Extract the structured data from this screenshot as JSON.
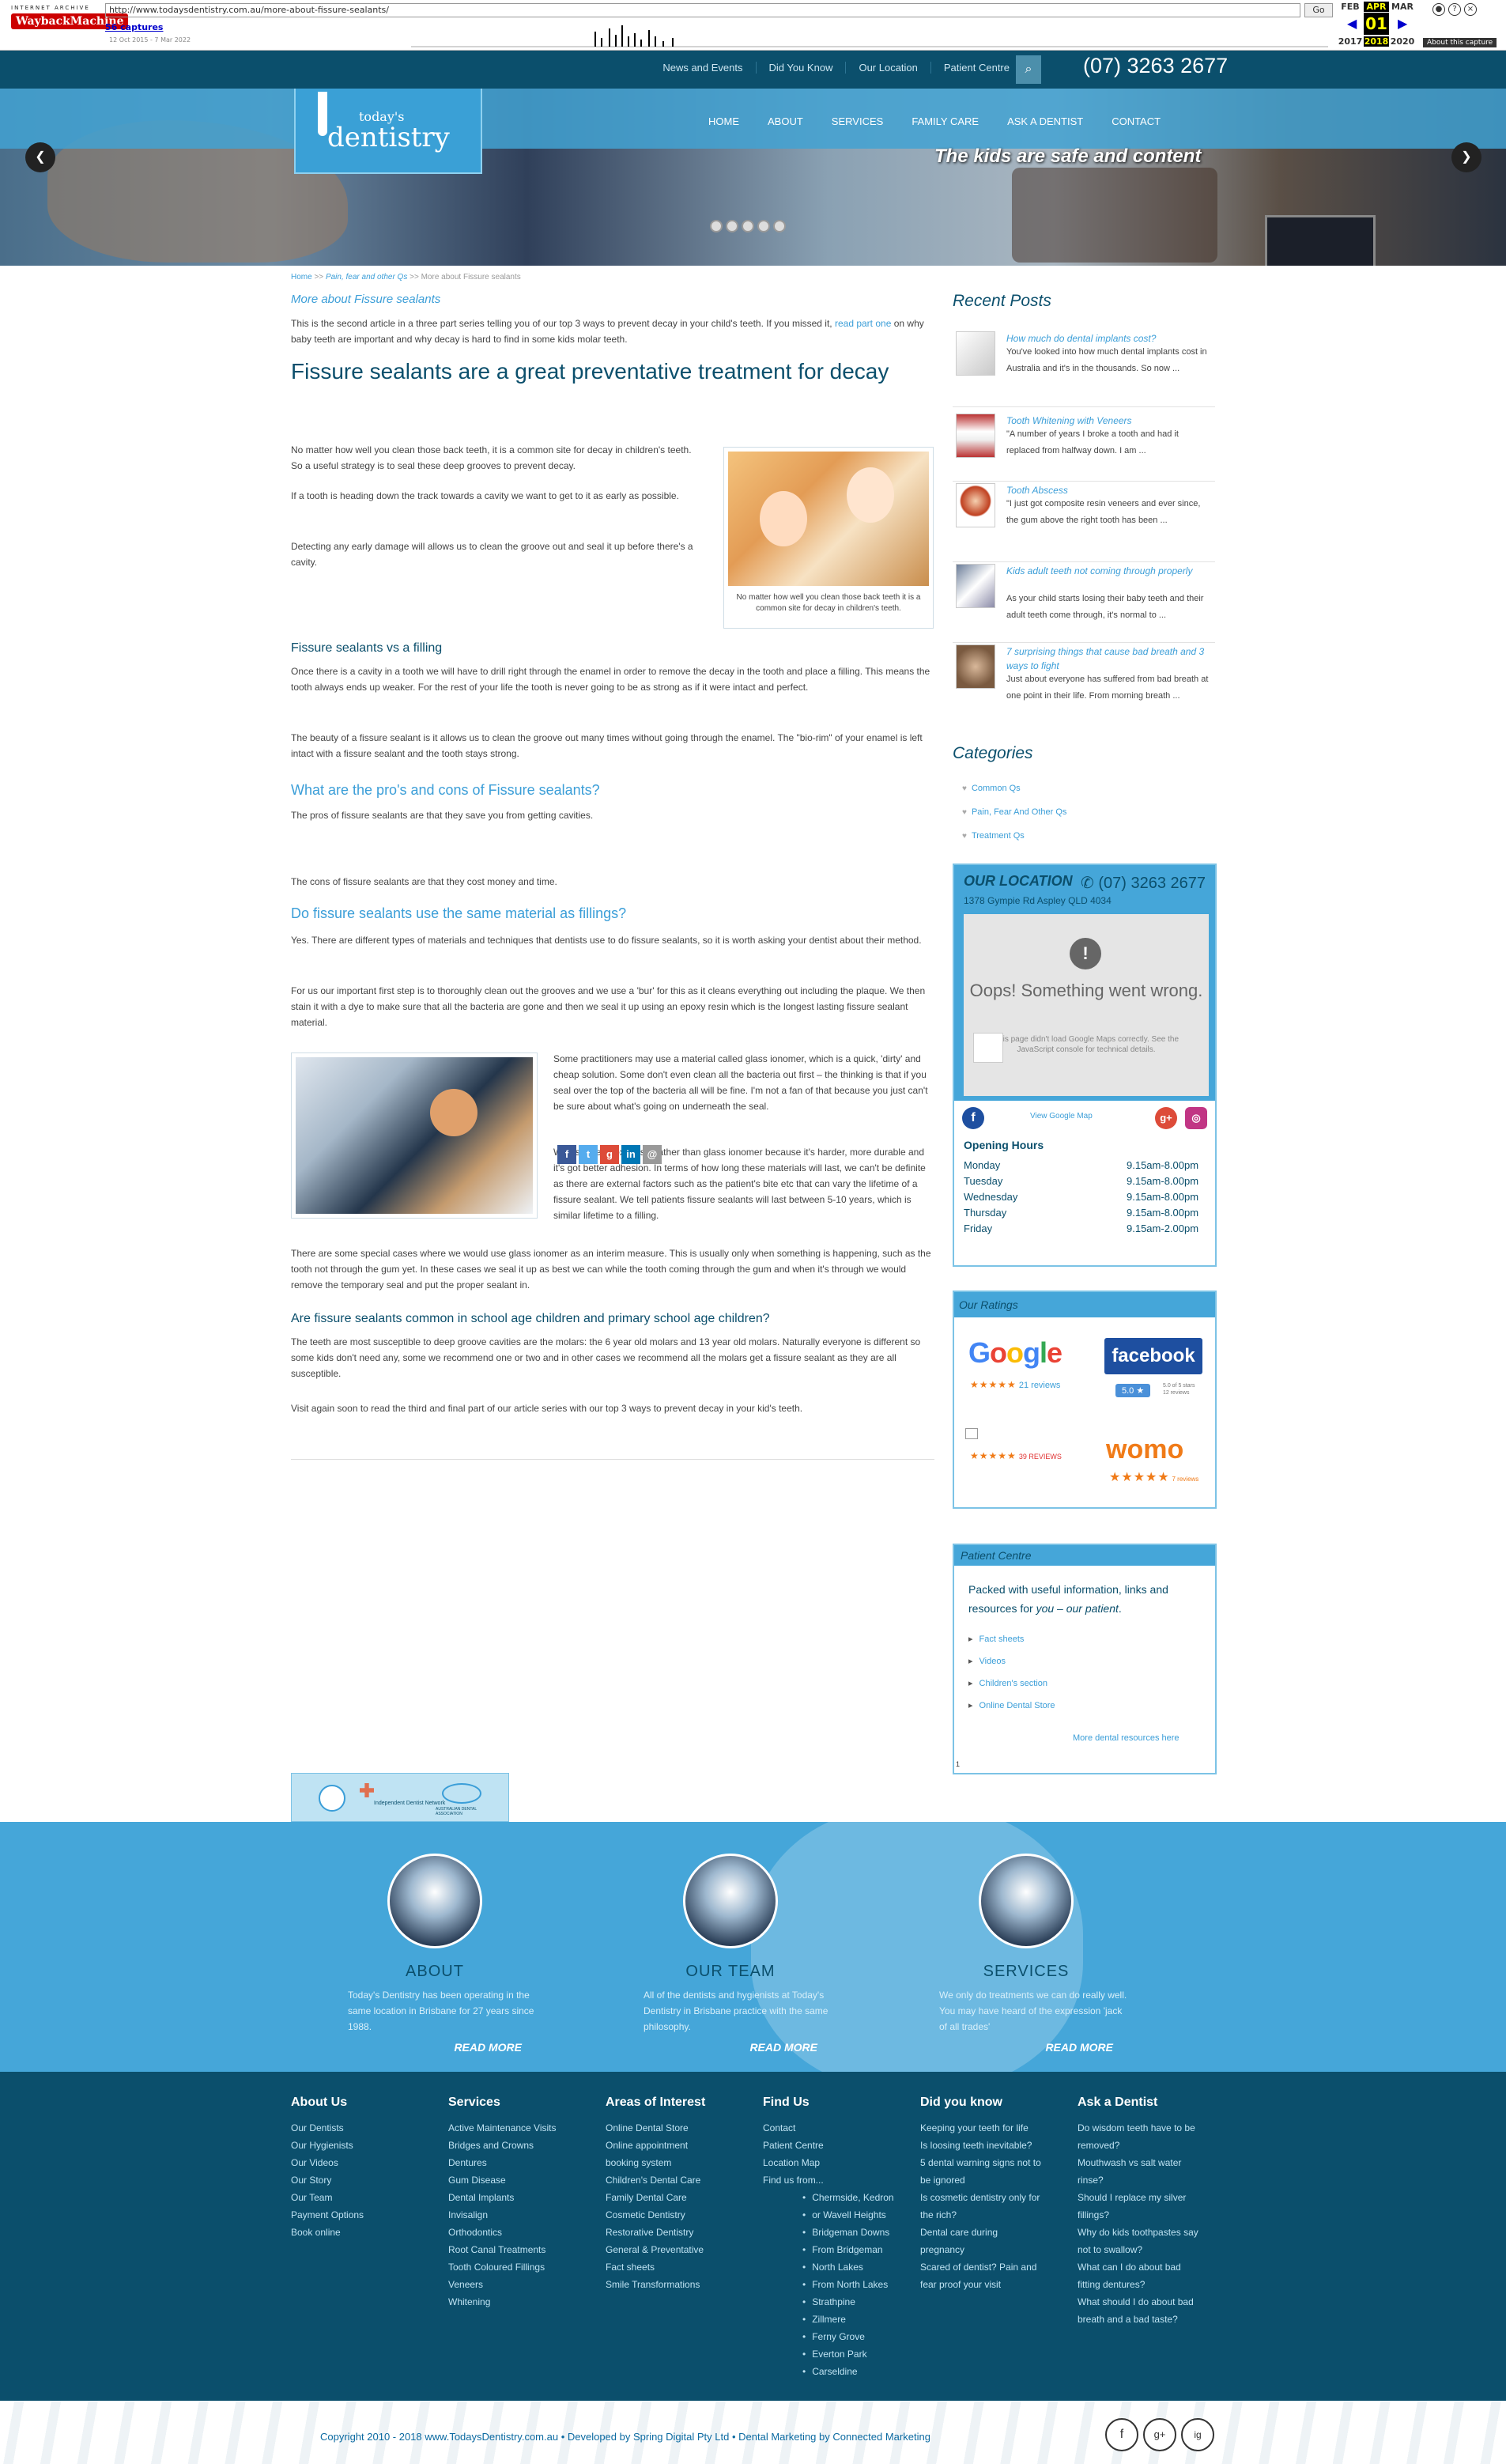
{
  "wayback": {
    "logo_top": "INTERNET ARCHIVE",
    "logo_main": "WaybackMachine",
    "url": "http://www.todaysdentistry.com.au/more-about-fissure-sealants/",
    "go": "Go",
    "captures": "56 captures",
    "range": "12 Oct 2015 - 7 Mar 2022",
    "months": [
      "FEB",
      "APR",
      "MAR"
    ],
    "day": "01",
    "years": [
      "2017",
      "2018",
      "2020"
    ],
    "about": "About this capture"
  },
  "topbar": {
    "links": [
      "News and Events",
      "Did You Know",
      "Our Location",
      "Patient Centre"
    ],
    "phone": "(07) 3263 2677"
  },
  "brand": {
    "todays": "today's",
    "dentistry": "dentistry"
  },
  "menu": [
    "HOME",
    "ABOUT",
    "SERVICES",
    "FAMILY CARE",
    "ASK A DENTIST",
    "CONTACT"
  ],
  "hero": {
    "caption": "The kids are safe and content",
    "slides": 5
  },
  "breadcrumb": {
    "home": "Home",
    "sep": ">>",
    "cat": "Pain, fear and other Qs",
    "current": "More about Fissure sealants"
  },
  "article": {
    "subtitle": "More about Fissure sealants",
    "intro_a": "This is the second article in a three part series telling you of our top 3 ways to prevent decay in your child's teeth. If you missed it,",
    "intro_link": "read part one",
    "intro_b": "on why baby teeth are important and why decay is hard to find in some kids molar teeth.",
    "h1": "Fissure sealants are a great preventative treatment for decay",
    "p1": "No matter how well you clean those back teeth, it is a common site for decay in children's teeth. So a useful strategy is to seal these deep grooves to prevent decay.",
    "p2": "If a tooth is heading down the track towards a cavity we want to get to it as early as possible.",
    "p3": "Detecting any early damage will allows us to clean the groove out and seal it up before there's a cavity.",
    "fig_caption": "No matter how well you clean those back teeth it is a common site for decay in children's teeth.",
    "h_filling": "Fissure sealants vs a filling",
    "p4": "Once there is a cavity in a tooth we will have to drill right through the enamel in order to remove the decay in the tooth and place a filling. This means the tooth always ends up weaker. For the rest of your life the tooth is never going to be as strong as if it were intact and perfect.",
    "p5": "The beauty of a fissure sealant is it allows us to clean the groove out many times without going through the enamel. The \"bio-rim\" of your enamel is left intact with a fissure sealant and the tooth stays strong.",
    "h_pros": "What are the pro's and cons of Fissure sealants?",
    "p6": "The pros of fissure sealants are that they save you from getting cavities.",
    "p7": "The cons of fissure sealants are that they cost money and time.",
    "h_same": "Do fissure sealants use the same material as fillings?",
    "p8": "Yes. There are different types of materials and techniques that dentists use to do fissure sealants, so it is worth asking your dentist about their method.",
    "p9": "For us our important first step is to thoroughly clean out the grooves and we use a 'bur' for this as it cleans everything out including the plaque. We then stain it with a dye to make sure that all the bacteria are gone and then we seal it up using an epoxy resin which is the longest lasting fissure sealant material.",
    "p10": "Some practitioners may use a material called glass ionomer, which is a quick, 'dirty' and cheap solution. Some don't even clean all the bacteria out first – the thinking is that if you seal over the top of the bacteria all will be fine. I'm not a fan of that because you just can't be sure about what's going on underneath the seal.",
    "p11": "We use the epoxy resin rather than glass ionomer because it's harder, more durable and it's got better adhesion. In terms of how long these materials will last, we can't be definite as there are external factors such as the patient's bite etc that can vary the lifetime of a fissure sealant. We tell patients fissure sealants will last between 5-10 years, which is similar lifetime to a filling.",
    "p12": "There are some special cases where we would use glass ionomer as an interim measure. This is usually only when something is happening, such as the tooth not through the gum yet. In these cases we seal it up as best we can while the tooth coming through the gum and when it's through we would remove the temporary seal and put the proper sealant in.",
    "h_school": "Are fissure sealants common in school age children and primary school age children?",
    "p13": "The teeth are most susceptible to deep groove cavities are the molars: the 6 year old molars and 13 year old molars. Naturally everyone is different so some kids don't need any, some we recommend one or two and in other cases we recommend all the molars get a fissure sealant as they are all susceptible.",
    "p14": "Visit again soon to read the third and final part of our article series with our top 3 ways to prevent decay in your kid's teeth."
  },
  "share": [
    {
      "icon": "f",
      "color": "#3b5998"
    },
    {
      "icon": "t",
      "color": "#55acee"
    },
    {
      "icon": "g",
      "color": "#dd4b39"
    },
    {
      "icon": "in",
      "color": "#0077b5"
    },
    {
      "icon": "@",
      "color": "#999999"
    }
  ],
  "sidebar": {
    "recent_title": "Recent Posts",
    "posts": [
      {
        "title": "How much do dental implants cost?",
        "excerpt": "You've looked into how much dental implants cost in Australia and it's in the thousands. So now ..."
      },
      {
        "title": "Tooth Whitening with Veneers",
        "excerpt": "\"A number of years I broke a tooth and had it replaced from halfway down. I am ..."
      },
      {
        "title": "Tooth Abscess",
        "excerpt": "\"I just got composite resin veneers and ever since, the gum above the right tooth has been ..."
      },
      {
        "title": "Kids adult teeth not coming through properly",
        "excerpt": "As your child starts losing their baby teeth and their adult teeth come through, it's normal to ..."
      },
      {
        "title": "7 surprising things that cause bad breath and 3 ways to fight",
        "excerpt": "Just about everyone has suffered from bad breath at one point in their life. From morning breath ..."
      }
    ],
    "cat_title": "Categories",
    "categories": [
      "Common Qs",
      "Pain, Fear And Other Qs",
      "Treatment Qs"
    ]
  },
  "location": {
    "title": "OUR LOCATION",
    "phone": "(07) 3263 2677",
    "address": "1378 Gympie Rd Aspley QLD 4034",
    "map_error": "Oops! Something went wrong.",
    "map_note": "This page didn't load Google Maps correctly. See the JavaScript console for technical details.",
    "view_map": "View Google Map",
    "hours_title": "Opening Hours",
    "hours": [
      {
        "day": "Monday",
        "time": "9.15am-8.00pm"
      },
      {
        "day": "Tuesday",
        "time": "9.15am-8.00pm"
      },
      {
        "day": "Wednesday",
        "time": "9.15am-8.00pm"
      },
      {
        "day": "Thursday",
        "time": "9.15am-8.00pm"
      },
      {
        "day": "Friday",
        "time": "9.15am-2.00pm"
      }
    ]
  },
  "ratings": {
    "title": "Our Ratings",
    "google": "Google",
    "google_reviews": "21 reviews",
    "facebook": "facebook",
    "fb_score": "5.0",
    "fb_note": "5.0 of 5 stars",
    "fb_reviews": "12 reviews",
    "other_reviews": "39 REVIEWS",
    "womo": "womo",
    "womo_reviews": "7 reviews"
  },
  "patient_centre": {
    "title": "Patient Centre",
    "intro_a": "Packed with useful information, links and resources for",
    "intro_em": "you – our patient",
    "intro_b": ".",
    "links": [
      "Fact sheets",
      "Videos",
      "Children's section",
      "Online Dental Store"
    ],
    "more": "More dental resources here",
    "stray": "1"
  },
  "badge": {
    "network": "Independent Dentist Network",
    "ada": "AUSTRALIAN DENTAL ASSOCIATION"
  },
  "features": [
    {
      "title": "ABOUT",
      "text": "Today's Dentistry has been operating in the same location in Brisbane for 27 years since 1988.",
      "more": "READ MORE"
    },
    {
      "title": "OUR TEAM",
      "text": "All of the dentists and hygienists at Today's Dentistry in Brisbane practice with the same philosophy.",
      "more": "READ MORE"
    },
    {
      "title": "SERVICES",
      "text": "We only do treatments we can do really well. You may have heard of the expression 'jack of all trades'",
      "more": "READ MORE"
    }
  ],
  "footer": {
    "cols": [
      {
        "title": "About Us",
        "links": [
          "Our Dentists",
          "Our Hygienists",
          "Our Videos",
          "Our Story",
          "Our Team",
          "Payment Options",
          "Book online"
        ]
      },
      {
        "title": "Services",
        "links": [
          "Active Maintenance Visits",
          "Bridges and Crowns",
          "Dentures",
          "Gum Disease",
          "Dental Implants",
          "Invisalign",
          "Orthodontics",
          "Root Canal Treatments",
          "Tooth Coloured Fillings",
          "Veneers",
          "Whitening"
        ]
      },
      {
        "title": "Areas of Interest",
        "links": [
          "Online Dental Store",
          "Online appointment",
          "booking system",
          "Children's Dental Care",
          "Family Dental Care",
          "Cosmetic Dentistry",
          "Restorative Dentistry",
          "General & Preventative",
          "Fact sheets",
          "Smile Transformations"
        ]
      },
      {
        "title": "Find Us",
        "links": [
          "Contact",
          "Patient Centre",
          "Location Map",
          "Find us from..."
        ],
        "sub": [
          "Chermside, Kedron",
          "or Wavell Heights",
          "Bridgeman Downs",
          "From Bridgeman",
          "North Lakes",
          "From North Lakes",
          "Strathpine",
          "Zillmere",
          "Ferny Grove",
          "Everton Park",
          "Carseldine"
        ]
      },
      {
        "title": "Did you know",
        "links": [
          "Keeping your teeth for life",
          "Is loosing teeth inevitable?",
          "5 dental warning signs not to",
          "be ignored",
          "Is cosmetic dentistry only for",
          "the rich?",
          "Dental care during",
          "pregnancy",
          "Scared of dentist? Pain and",
          "fear proof your visit"
        ]
      },
      {
        "title": "Ask a Dentist",
        "links": [
          "Do wisdom teeth have to be",
          "removed?",
          "Mouthwash vs salt water",
          "rinse?",
          "Should I replace my silver",
          "fillings?",
          "Why do kids toothpastes say",
          "not to swallow?",
          "What can I do about bad",
          "fitting dentures?",
          "What should I do about bad",
          "breath and a bad taste?"
        ]
      }
    ],
    "copyright_a": "Copyright 2010 - 2018 www.TodaysDentistry.com.au",
    "copyright_b": " • Developed by Spring Digital Pty Ltd • Dental Marketing by Connected Marketing",
    "social": [
      "f",
      "g+",
      "ig"
    ]
  }
}
